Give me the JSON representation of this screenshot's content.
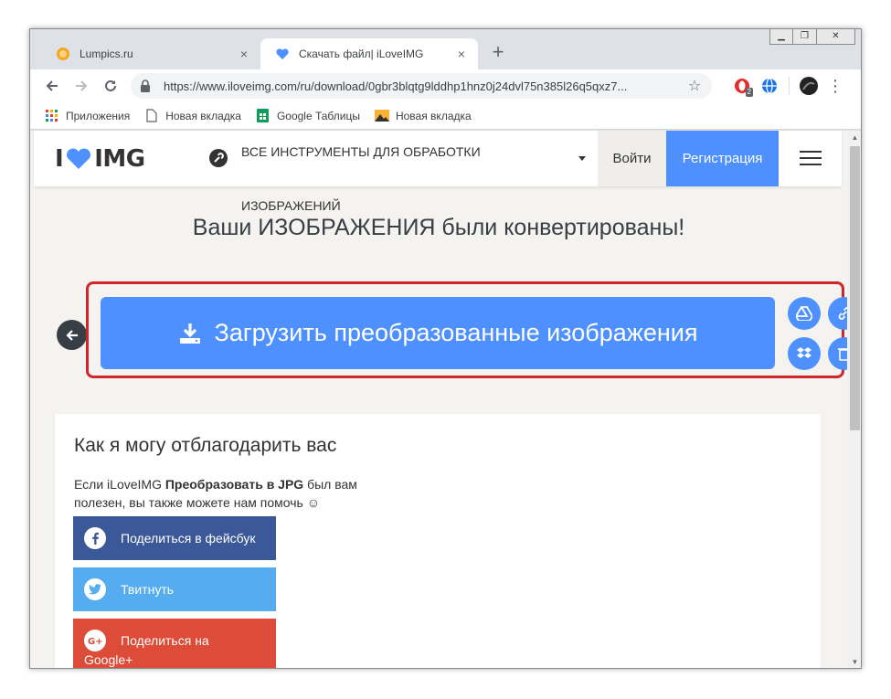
{
  "browser": {
    "tabs": [
      {
        "title": "Lumpics.ru",
        "active": false
      },
      {
        "title": "Скачать файл| iLoveIMG",
        "active": true
      }
    ],
    "new_tab_label": "+",
    "close_glyph": "×",
    "url": "https://www.iloveimg.com/ru/download/0gbr3blqtg9lddhp1hnz0j24dvl75n385l26q5qxz7...",
    "extension_badge": "2",
    "bookmarks": [
      {
        "label": "Приложения",
        "icon": "apps-grid-icon"
      },
      {
        "label": "Новая вкладка",
        "icon": "page-icon"
      },
      {
        "label": "Google Таблицы",
        "icon": "sheets-icon"
      },
      {
        "label": "Новая вкладка",
        "icon": "image-icon"
      }
    ]
  },
  "site": {
    "logo_left": "I",
    "logo_right": "IMG",
    "tools_label": "ВСЕ ИНСТРУМЕНТЫ ДЛЯ ОБРАБОТКИ ИЗОБРАЖЕНИЙ",
    "login": "Войти",
    "register": "Регистрация",
    "brand_color": "#4d90fe"
  },
  "main": {
    "heading": "Ваши ИЗОБРАЖЕНИЯ были конвертированы!",
    "download_button": "Загрузить преобразованные изображения",
    "side_actions": [
      "google-drive-icon",
      "dropbox-icon",
      "link-icon",
      "trash-icon"
    ]
  },
  "thanks": {
    "title": "Как я могу отблагодарить вас",
    "desc_pre": "Если iLoveIMG ",
    "desc_bold": "Преобразовать в JPG",
    "desc_post": " был вам полезен, вы также можете нам помочь ☺",
    "share_facebook": "Поделиться в фейсбук",
    "share_twitter": "Твитнуть",
    "share_google_line1": "Поделиться на",
    "share_google_line2": "Google+",
    "colors": {
      "facebook": "#3b5998",
      "twitter": "#55acee",
      "google": "#dd4b39",
      "linkedin": "#0e76a8"
    }
  }
}
